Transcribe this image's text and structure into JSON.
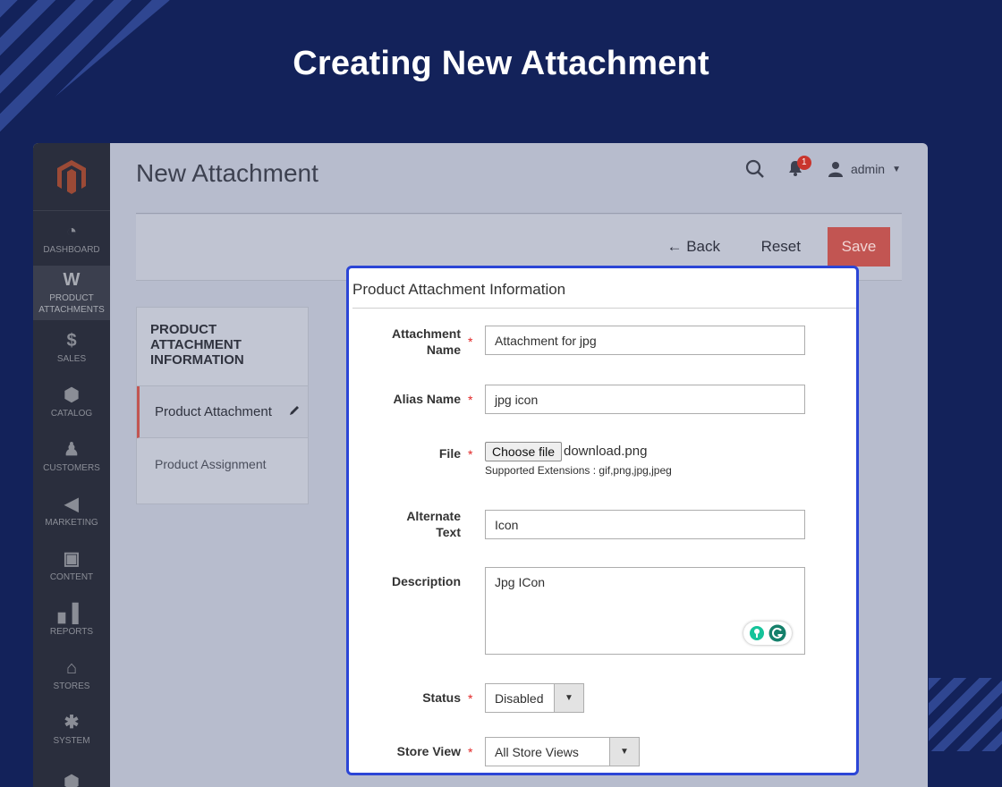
{
  "banner": {
    "title": "Creating New Attachment"
  },
  "sidebar": {
    "items": [
      {
        "label": "DASHBOARD",
        "icon": "dashboard-icon"
      },
      {
        "label": "PRODUCT ATTACHMENTS",
        "icon": "w-logo-icon"
      },
      {
        "label": "SALES",
        "icon": "dollar-icon"
      },
      {
        "label": "CATALOG",
        "icon": "cube-icon"
      },
      {
        "label": "CUSTOMERS",
        "icon": "person-icon"
      },
      {
        "label": "MARKETING",
        "icon": "megaphone-icon"
      },
      {
        "label": "CONTENT",
        "icon": "layout-icon"
      },
      {
        "label": "REPORTS",
        "icon": "bar-chart-icon"
      },
      {
        "label": "STORES",
        "icon": "store-icon"
      },
      {
        "label": "SYSTEM",
        "icon": "gear-icon"
      }
    ]
  },
  "header": {
    "page_title": "New Attachment",
    "notification_count": "1",
    "user": "admin"
  },
  "actions": {
    "back": "Back",
    "reset": "Reset",
    "save": "Save"
  },
  "tabs": {
    "heading": "PRODUCT ATTACHMENT INFORMATION",
    "items": [
      "Product Attachment",
      "Product Assignment"
    ]
  },
  "form": {
    "title": "Product Attachment Information",
    "attachment_name": {
      "label": "Attachment Name",
      "value": "Attachment for jpg"
    },
    "alias_name": {
      "label": "Alias Name",
      "value": "jpg icon"
    },
    "file": {
      "label": "File",
      "button": "Choose file",
      "filename": "download.png",
      "note": "Supported Extensions : gif,png,jpg,jpeg"
    },
    "alternate_text": {
      "label": "Alternate Text",
      "value": "Icon"
    },
    "description": {
      "label": "Description",
      "value": "Jpg ICon"
    },
    "status": {
      "label": "Status",
      "value": "Disabled"
    },
    "store_view": {
      "label": "Store View",
      "value": "All Store Views"
    },
    "required_mark": "*"
  },
  "colors": {
    "background": "#13225a",
    "accent_border": "#2b45d6",
    "save_button": "#c25552",
    "required": "#e22626"
  }
}
